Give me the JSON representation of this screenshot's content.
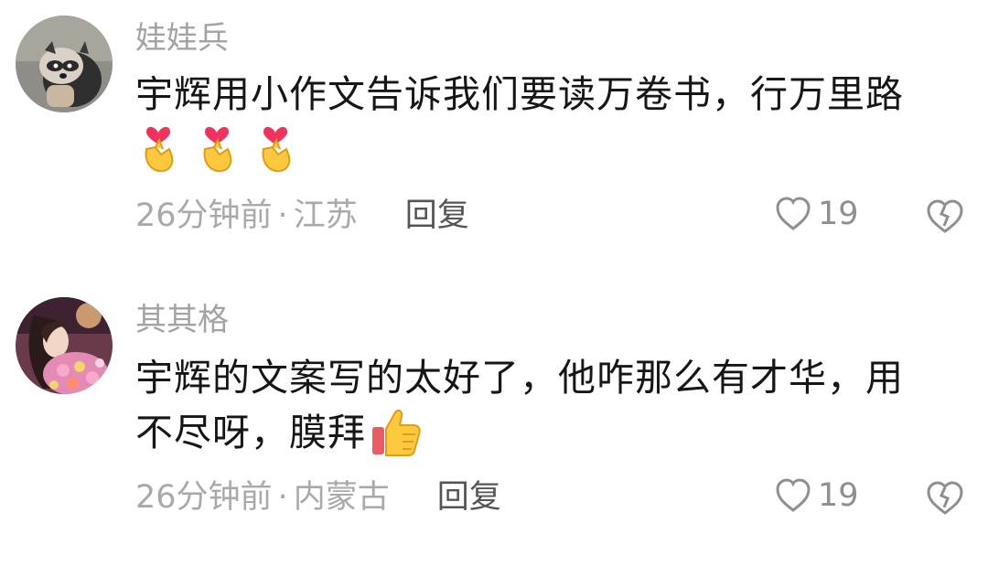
{
  "comments": [
    {
      "username": "娃娃兵",
      "text": "宇辉用小作文告诉我们要读万卷书，行万里路",
      "emojis": [
        "finger-heart-icon",
        "finger-heart-icon",
        "finger-heart-icon"
      ],
      "time": "26分钟前",
      "location": "江苏",
      "separator": "·",
      "reply_label": "回复",
      "likes": "19"
    },
    {
      "username": "其其格",
      "text_line1": "宇辉的文案写的太好了，他咋那么有才华，用",
      "text_line2": "不尽呀，膜拜",
      "emojis": [
        "thumbs-up-icon"
      ],
      "time": "26分钟前",
      "location": "内蒙古",
      "separator": "·",
      "reply_label": "回复",
      "likes": "19"
    }
  ],
  "colors": {
    "username": "#a3a3a3",
    "text": "#161616",
    "meta": "#a9a9a9",
    "reply": "#555555",
    "icon": "#8f8f8f"
  }
}
